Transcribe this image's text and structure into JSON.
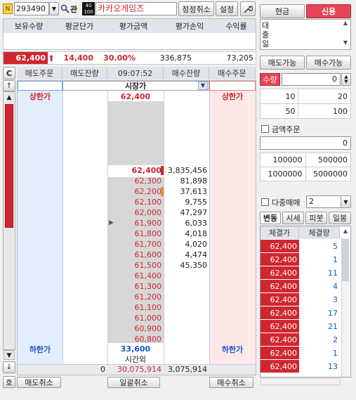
{
  "stock": {
    "code": "293490",
    "gwan": "관",
    "badge_top": "40",
    "badge_bot": "100",
    "name": "카카오게임즈",
    "n_label": "N"
  },
  "top_buttons": {
    "cancel": "정정취소",
    "settings": "설정"
  },
  "pos_headers": [
    "보유수량",
    "평균단가",
    "평가금액",
    "평가손익",
    "수익률"
  ],
  "price_line": {
    "price": "62,400",
    "arrow": "⬆",
    "change": "14,400",
    "pct": "30.00%",
    "volume": "336,875",
    "amount": "73,205"
  },
  "ob_headers": {
    "c": "C",
    "sell_order": "매도주문",
    "sell_rem": "매도잔량",
    "time": "09:07:52",
    "buy_rem": "매수잔량",
    "buy_order": "매수주문"
  },
  "market_label": "시장가",
  "upper_limit_label": "상한가",
  "upper_limit_price": "62,400",
  "lower_limit_label": "하한가",
  "lower_limit_price": "33,600",
  "after_hours": "시간외",
  "footer_row": {
    "sell_total": "0",
    "volume": "30,075,914",
    "buy_total": "3,075,914"
  },
  "prices": [
    {
      "p": "62,400",
      "cur": true,
      "qty": "3,835,456"
    },
    {
      "p": "62,300",
      "qty": "81,898"
    },
    {
      "p": "62,200",
      "qty": "37,613"
    },
    {
      "p": "62,100",
      "qty": "9,755"
    },
    {
      "p": "62,000",
      "qty": "47,297"
    },
    {
      "p": "61,900",
      "qty": "6,033",
      "mark": true
    },
    {
      "p": "61,800",
      "qty": "4,018"
    },
    {
      "p": "61,700",
      "qty": "4,020"
    },
    {
      "p": "61,600",
      "qty": "4,474"
    },
    {
      "p": "61,500",
      "qty": "45,350"
    },
    {
      "p": "61,400",
      "qty": ""
    },
    {
      "p": "61,300",
      "qty": ""
    },
    {
      "p": "61,200",
      "qty": ""
    },
    {
      "p": "61,100",
      "qty": ""
    },
    {
      "p": "61,000",
      "qty": ""
    },
    {
      "p": "60,900",
      "qty": ""
    },
    {
      "p": "60,800",
      "qty": ""
    }
  ],
  "bottom_buttons": {
    "sell_cancel": "매도취소",
    "all_cancel": "일괄취소",
    "buy_cancel": "매수취소",
    "left": "호"
  },
  "right": {
    "cash": "현금",
    "credit": "신용",
    "loan_label": "대출일",
    "sell_avail": "매도가능",
    "buy_avail": "매수가능",
    "qty_label": "수량",
    "qty_value": "0",
    "qty_presets": [
      [
        "10",
        "20"
      ],
      [
        "50",
        "100"
      ]
    ],
    "amount_label": "금액주문",
    "amount_value": "0",
    "amount_presets": [
      [
        "100000",
        "500000"
      ],
      [
        "1000000",
        "5000000"
      ]
    ],
    "multi_label": "다중매매",
    "multi_value": "2",
    "tabs": [
      "변동",
      "시세",
      "피봇",
      "일봉"
    ],
    "trade_headers": [
      "체결가",
      "체결량"
    ],
    "trades": [
      {
        "p": "62,400",
        "q": "5"
      },
      {
        "p": "62,400",
        "q": "1"
      },
      {
        "p": "62,400",
        "q": "11"
      },
      {
        "p": "62,400",
        "q": "4"
      },
      {
        "p": "62,400",
        "q": "3"
      },
      {
        "p": "62,400",
        "q": "17"
      },
      {
        "p": "62,400",
        "q": "21"
      },
      {
        "p": "62,400",
        "q": "2"
      },
      {
        "p": "62,400",
        "q": "1"
      },
      {
        "p": "62,400",
        "q": "13"
      }
    ]
  }
}
